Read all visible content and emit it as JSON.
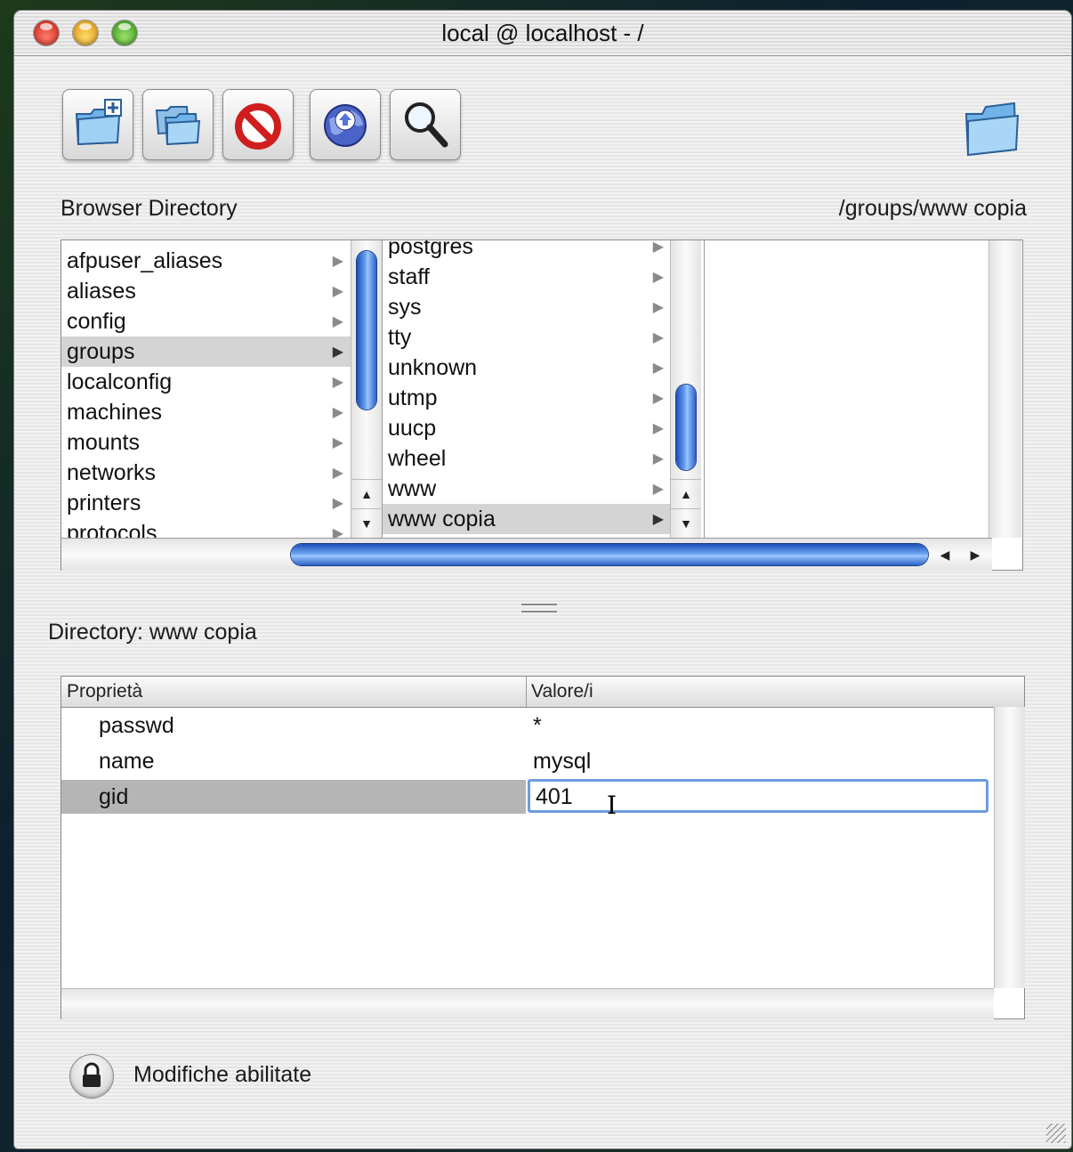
{
  "window": {
    "title": "local @ localhost - /"
  },
  "toolbar": {
    "buttons": [
      {
        "name": "new-directory-button",
        "icon": "folder-plus-icon"
      },
      {
        "name": "duplicate-directory-button",
        "icon": "folders-icon"
      },
      {
        "name": "delete-directory-button",
        "icon": "prohibited-icon"
      },
      {
        "name": "network-button",
        "icon": "globe-upload-icon"
      },
      {
        "name": "search-button",
        "icon": "magnifier-icon"
      }
    ],
    "right_icon": "folder-icon"
  },
  "browser": {
    "header_label": "Browser Directory",
    "path": "/groups/www copia",
    "column1": [
      "afpuser_aliases",
      "aliases",
      "config",
      "groups",
      "localconfig",
      "machines",
      "mounts",
      "networks",
      "printers",
      "protocols"
    ],
    "column1_selected": "groups",
    "column2": [
      "postgres",
      "staff",
      "sys",
      "tty",
      "unknown",
      "utmp",
      "uucp",
      "wheel",
      "www",
      "www copia"
    ],
    "column2_selected": "www copia"
  },
  "directory": {
    "label": "Directory: www copia",
    "columns": {
      "property": "Proprietà",
      "value": "Valore/i"
    },
    "rows": [
      {
        "key": "passwd",
        "value": "*"
      },
      {
        "key": "name",
        "value": "mysql"
      },
      {
        "key": "gid",
        "value": "401"
      }
    ],
    "editing_row": "gid"
  },
  "footer": {
    "lock_label": "Modifiche abilitate"
  },
  "colors": {
    "accent": "#3a7ae0",
    "selection": "#d4d4d4"
  }
}
